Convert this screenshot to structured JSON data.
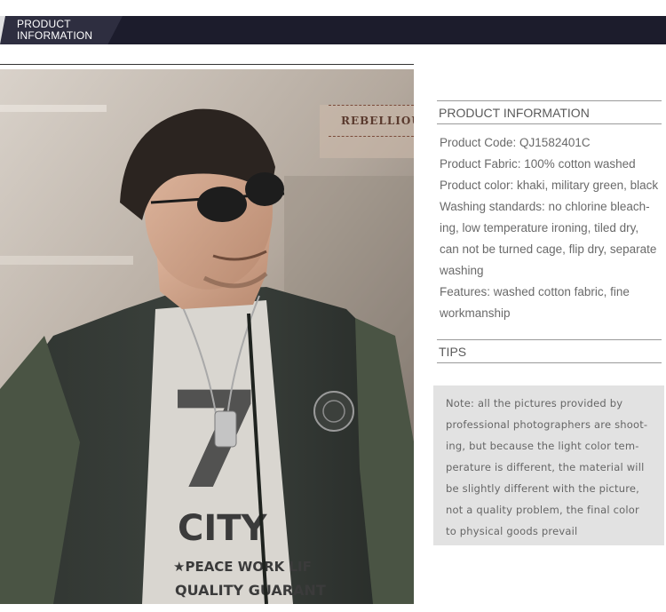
{
  "banner": {
    "title_line1": "PRODUCT",
    "title_line2": "INFORMATION"
  },
  "photo": {
    "sign_text": "REBELLIOU"
  },
  "product_information": {
    "heading": "PRODUCT INFORMATION",
    "lines": [
      "Product Code: QJ1582401C",
      "Product Fabric: 100% cotton washed",
      "Product color: khaki, military green, black",
      "Washing standards: no chlorine bleach-",
      "ing, low temperature ironing, tiled dry,",
      "can not be turned cage, flip dry, separate",
      "washing",
      "Features: washed cotton fabric, fine",
      "workmanship"
    ]
  },
  "tips": {
    "heading": "TIPS",
    "note_lines": [
      "Note: all the pictures provided by",
      "professional photographers are shoot-",
      "ing, but because the light color tem-",
      "perature is different, the material will",
      "be slightly different with the picture,",
      "not a quality problem, the final color",
      "to physical goods prevail"
    ]
  },
  "photo_shirt_text": {
    "number": "7",
    "city": "CITY",
    "line1": "★PEACE WORK LIF",
    "line2": "QUALITY GUARANT"
  },
  "colors": {
    "banner": "#1c1c2c",
    "banner_tab": "#2e2e40",
    "note_bg": "#e2e2e2",
    "text": "#6a6a6a"
  }
}
